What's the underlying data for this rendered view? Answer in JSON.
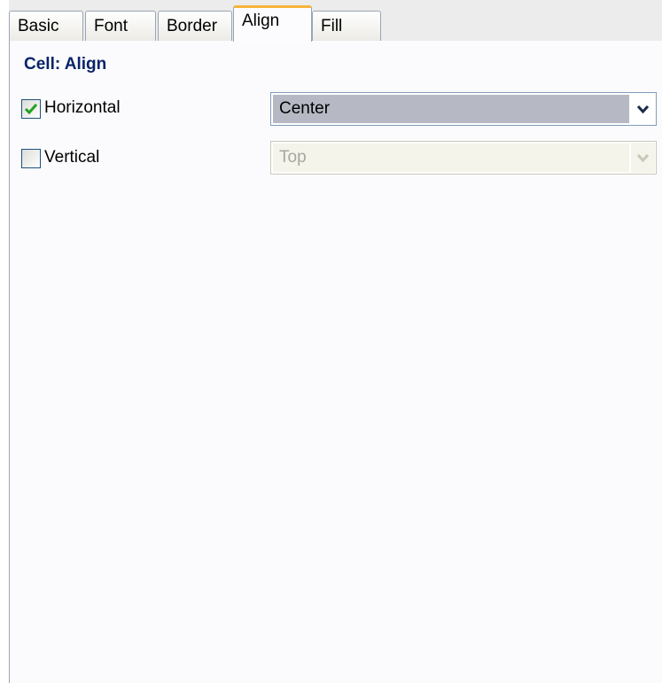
{
  "tabs": [
    {
      "label": "Basic",
      "active": false
    },
    {
      "label": "Font",
      "active": false
    },
    {
      "label": "Border",
      "active": false
    },
    {
      "label": "Align",
      "active": true
    },
    {
      "label": "Fill",
      "active": false
    }
  ],
  "panel": {
    "title": "Cell: Align",
    "horizontal": {
      "label": "Horizontal",
      "checked": true,
      "value": "Center",
      "enabled": true
    },
    "vertical": {
      "label": "Vertical",
      "checked": false,
      "value": "Top",
      "enabled": false
    }
  },
  "colors": {
    "title": "#0a246a",
    "active_tab_accent": "#f8b43a",
    "check_mark": "#21a121",
    "selected_value_bg": "#b6b9c3"
  }
}
